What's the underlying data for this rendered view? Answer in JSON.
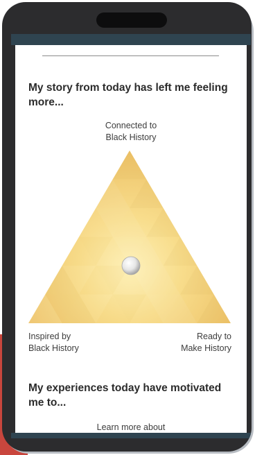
{
  "survey": {
    "question_1": "My story from today has left me feeling more...",
    "label_top": "Connected to\nBlack History",
    "label_left": "Inspired by\nBlack History",
    "label_right": "Ready to\nMake History",
    "question_2": "My experiences today have motivated me to...",
    "option_first": "Learn more about"
  },
  "colors": {
    "triangle_light": "#fbe7a2",
    "triangle_dark": "#efc76a",
    "screen_bar": "#2f4450",
    "phone_body": "#2c2c2e",
    "accent_red": "#c9463d"
  }
}
